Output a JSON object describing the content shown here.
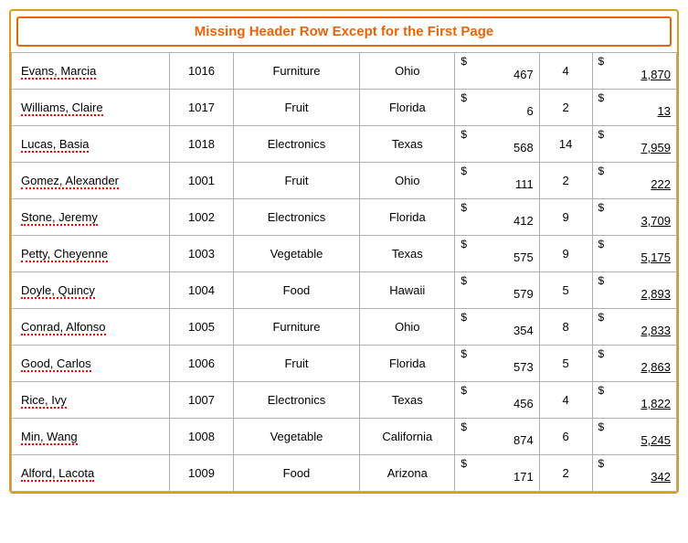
{
  "header": {
    "title": "Missing Header Row Except for the First Page"
  },
  "rows": [
    {
      "name": "Evans, Marcia",
      "id": "1016",
      "category": "Furniture",
      "state": "Ohio",
      "unit_price_dollar": "$",
      "unit_price": "467",
      "qty": "4",
      "total_dollar": "$",
      "total": "1,870"
    },
    {
      "name": "Williams, Claire",
      "id": "1017",
      "category": "Fruit",
      "state": "Florida",
      "unit_price_dollar": "$",
      "unit_price": "6",
      "qty": "2",
      "total_dollar": "$",
      "total": "13"
    },
    {
      "name": "Lucas, Basia",
      "id": "1018",
      "category": "Electronics",
      "state": "Texas",
      "unit_price_dollar": "$",
      "unit_price": "568",
      "qty": "14",
      "total_dollar": "$",
      "total": "7,959"
    },
    {
      "name": "Gomez, Alexander",
      "id": "1001",
      "category": "Fruit",
      "state": "Ohio",
      "unit_price_dollar": "$",
      "unit_price": "111",
      "qty": "2",
      "total_dollar": "$",
      "total": "222"
    },
    {
      "name": "Stone, Jeremy",
      "id": "1002",
      "category": "Electronics",
      "state": "Florida",
      "unit_price_dollar": "$",
      "unit_price": "412",
      "qty": "9",
      "total_dollar": "$",
      "total": "3,709"
    },
    {
      "name": "Petty, Cheyenne",
      "id": "1003",
      "category": "Vegetable",
      "state": "Texas",
      "unit_price_dollar": "$",
      "unit_price": "575",
      "qty": "9",
      "total_dollar": "$",
      "total": "5,175"
    },
    {
      "name": "Doyle, Quincy",
      "id": "1004",
      "category": "Food",
      "state": "Hawaii",
      "unit_price_dollar": "$",
      "unit_price": "579",
      "qty": "5",
      "total_dollar": "$",
      "total": "2,893"
    },
    {
      "name": "Conrad, Alfonso",
      "id": "1005",
      "category": "Furniture",
      "state": "Ohio",
      "unit_price_dollar": "$",
      "unit_price": "354",
      "qty": "8",
      "total_dollar": "$",
      "total": "2,833"
    },
    {
      "name": "Good, Carlos",
      "id": "1006",
      "category": "Fruit",
      "state": "Florida",
      "unit_price_dollar": "$",
      "unit_price": "573",
      "qty": "5",
      "total_dollar": "$",
      "total": "2,863"
    },
    {
      "name": "Rice, Ivy",
      "id": "1007",
      "category": "Electronics",
      "state": "Texas",
      "unit_price_dollar": "$",
      "unit_price": "456",
      "qty": "4",
      "total_dollar": "$",
      "total": "1,822"
    },
    {
      "name": "Min, Wang",
      "id": "1008",
      "category": "Vegetable",
      "state": "California",
      "unit_price_dollar": "$",
      "unit_price": "874",
      "qty": "6",
      "total_dollar": "$",
      "total": "5,245"
    },
    {
      "name": "Alford, Lacota",
      "id": "1009",
      "category": "Food",
      "state": "Arizona",
      "unit_price_dollar": "$",
      "unit_price": "171",
      "qty": "2",
      "total_dollar": "$",
      "total": "342"
    }
  ]
}
